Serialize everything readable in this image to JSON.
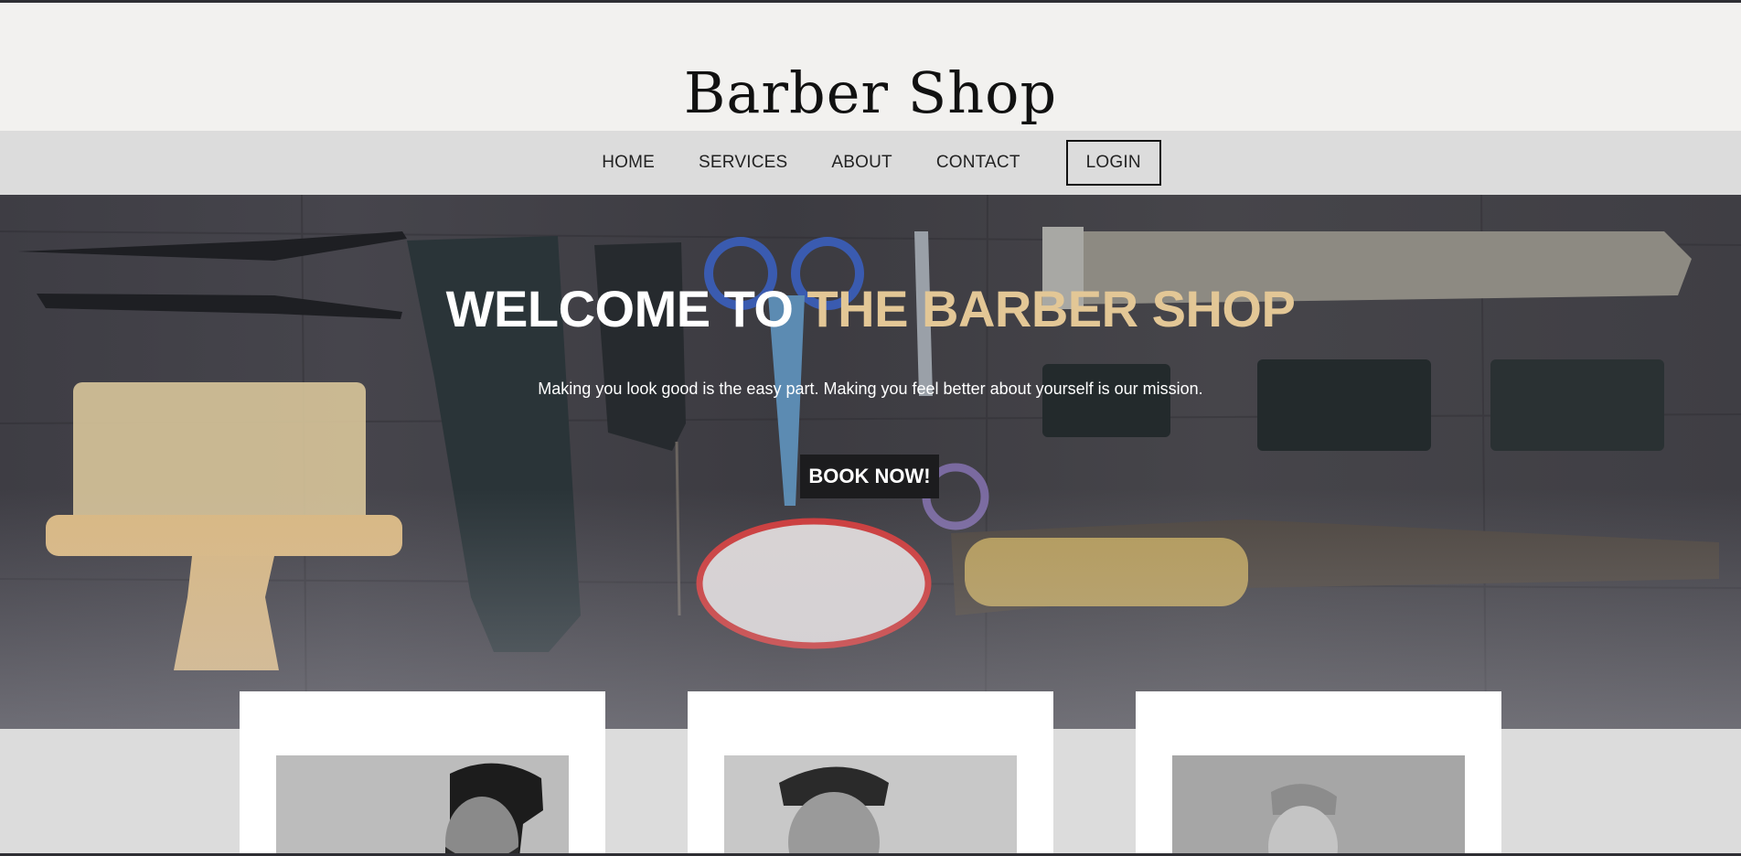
{
  "brand": {
    "name": "Barber Shop"
  },
  "nav": {
    "items": [
      {
        "label": "HOME"
      },
      {
        "label": "SERVICES"
      },
      {
        "label": "ABOUT"
      },
      {
        "label": "CONTACT"
      }
    ],
    "login_label": "LOGIN"
  },
  "hero": {
    "title_lead": "WELCOME TO",
    "title_accent": "THE BARBER SHOP",
    "subtitle": "Making you look good is the easy part. Making you feel better about yourself is our mission.",
    "cta_label": "BOOK NOW!"
  },
  "barbers": [
    {
      "photo": "barber-photo-1"
    },
    {
      "photo": "barber-photo-2"
    },
    {
      "photo": "barber-photo-3"
    }
  ],
  "colors": {
    "accent": "#e3c796",
    "header_bg": "#f2f1ef",
    "nav_bg": "#dcdcdc",
    "cta_bg": "#1c1c1e"
  }
}
